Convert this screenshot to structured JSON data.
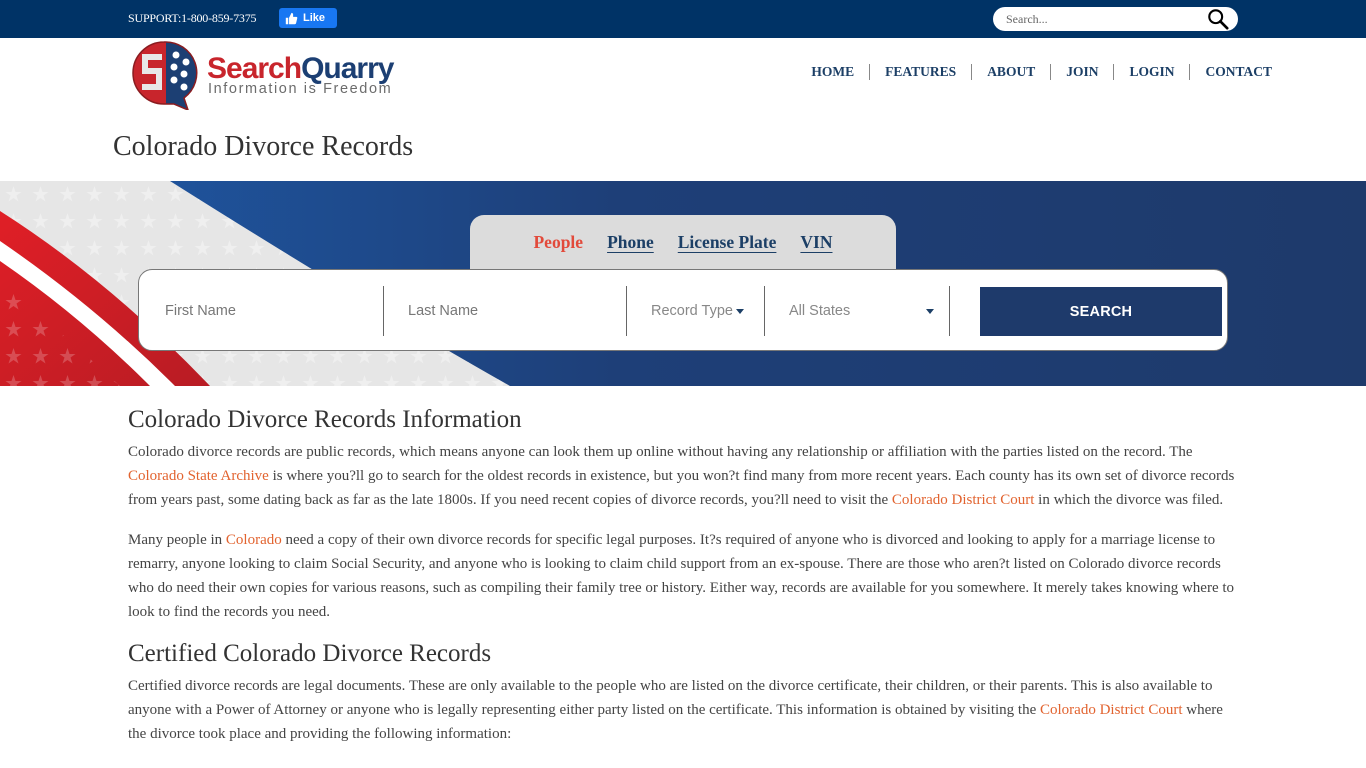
{
  "topbar": {
    "support_text": "SUPPORT:1-800-859-7375",
    "like_label": "Like",
    "search_placeholder": "Search..."
  },
  "logo": {
    "brand_part1": "Search",
    "brand_part2": "Quarry",
    "tagline": "Information is Freedom"
  },
  "nav": {
    "items": [
      {
        "label": "HOME"
      },
      {
        "label": "FEATURES"
      },
      {
        "label": "ABOUT"
      },
      {
        "label": "JOIN"
      },
      {
        "label": "LOGIN"
      },
      {
        "label": "CONTACT"
      }
    ]
  },
  "page_title": "Colorado Divorce Records",
  "search_tabs": [
    {
      "label": "People",
      "active": true
    },
    {
      "label": "Phone",
      "active": false
    },
    {
      "label": "License Plate",
      "active": false
    },
    {
      "label": "VIN",
      "active": false
    }
  ],
  "search_form": {
    "first_name_placeholder": "First Name",
    "last_name_placeholder": "Last Name",
    "record_type_label": "Record Type",
    "state_label": "All States",
    "submit_label": "SEARCH"
  },
  "content": {
    "section1": {
      "heading": "Colorado Divorce Records Information",
      "p1": {
        "t1": "Colorado divorce records are public records, which means anyone can look them up online without having any relationship or affiliation with the parties listed on the record. The ",
        "link1": "Colorado State Archive",
        "t2": " is where you?ll go to search for the oldest records in existence, but you won?t find many from more recent years. Each county has its own set of divorce records from years past, some dating back as far as the late 1800s. If you need recent copies of divorce records, you?ll need to visit the ",
        "link2": "Colorado District Court",
        "t3": " in which the divorce was filed."
      },
      "p2": {
        "t1": "Many people in ",
        "link1": "Colorado",
        "t2": " need a copy of their own divorce records for specific legal purposes. It?s required of anyone who is divorced and looking to apply for a marriage license to remarry, anyone looking to claim Social Security, and anyone who is looking to claim child support from an ex-spouse. There are those who aren?t listed on Colorado divorce records who do need their own copies for various reasons, such as compiling their family tree or history. Either way, records are available for you somewhere. It merely takes knowing where to look to find the records you need."
      }
    },
    "section2": {
      "heading": "Certified Colorado Divorce Records",
      "p1": {
        "t1": "Certified divorce records are legal documents. These are only available to the people who are listed on the divorce certificate, their children, or their parents. This is also available to anyone with a Power of Attorney or anyone who is legally representing either party listed on the certificate. This information is obtained by visiting the ",
        "link1": "Colorado District Court",
        "t2": " where the divorce took place and providing the following information:"
      }
    }
  },
  "colors": {
    "topbar_bg": "#003366",
    "nav_text": "#1c3f66",
    "brand_red": "#c8252c",
    "brand_blue": "#1c3f73",
    "active_tab": "#e24a3b",
    "link": "#e2632f",
    "search_button": "#1e3a6b",
    "facebook": "#1877f2"
  }
}
